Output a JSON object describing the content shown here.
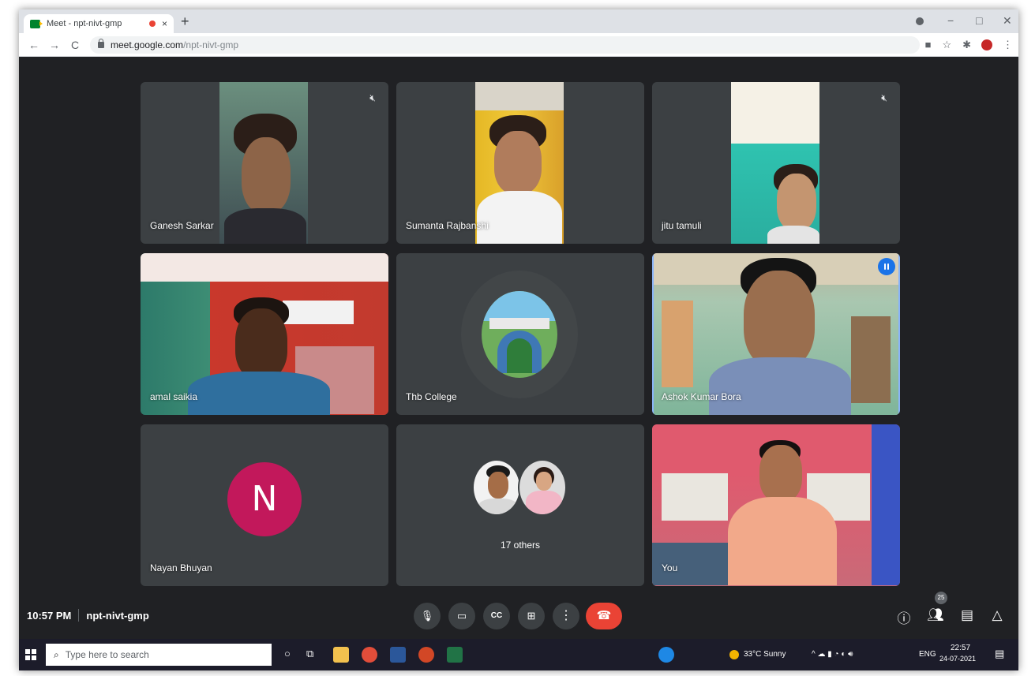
{
  "browser": {
    "tab_title": "Meet - npt-nivt-gmp",
    "tab_close": "×",
    "new_tab": "+",
    "url_domain": "meet.google.com",
    "url_path": "/npt-nivt-gmp",
    "window_controls": {
      "minimize": "−",
      "maximize": "□",
      "close": "✕"
    },
    "nav": {
      "back": "←",
      "forward": "→",
      "reload": "C"
    }
  },
  "participants": [
    {
      "name": "Ganesh Sarkar",
      "muted": true
    },
    {
      "name": "Sumanta Rajbanshi",
      "muted": false
    },
    {
      "name": "jitu tamuli",
      "muted": true
    },
    {
      "name": "amal saikia",
      "muted": false
    },
    {
      "name": "Thb College",
      "muted": false
    },
    {
      "name": "Ashok Kumar Bora",
      "muted": false,
      "speaking": true
    },
    {
      "name": "Nayan Bhuyan",
      "muted": false,
      "avatar_letter": "N",
      "avatar_color": "#c2185b"
    },
    {
      "name": "",
      "others_label": "17 others"
    },
    {
      "name": "You",
      "muted": false
    }
  ],
  "bottom_bar": {
    "time": "10:57 PM",
    "meeting_code": "npt-nivt-gmp",
    "controls": [
      "mic-icon",
      "camera-icon",
      "captions-icon",
      "present-icon",
      "more-options-icon",
      "end-call-icon"
    ],
    "participant_count": "25",
    "captions_label": "CC"
  },
  "taskbar": {
    "search_placeholder": "Type here to search",
    "weather": "33°C  Sunny",
    "language": "ENG",
    "clock_time": "22:57",
    "clock_date": "24-07-2021"
  },
  "colors": {
    "meet_bg": "#202124",
    "tile_bg": "#3c4043",
    "hangup": "#ea4335",
    "speaker_ring": "#8ab4f8"
  }
}
